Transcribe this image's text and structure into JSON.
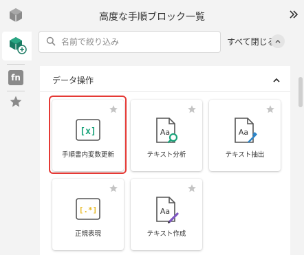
{
  "panel": {
    "title": "高度な手順ブロック一覧",
    "expand_icon": "double-chevron-right-icon"
  },
  "search": {
    "placeholder": "名前で絞り込み",
    "value": ""
  },
  "toolbar": {
    "collapse_all_label": "すべて閉じる"
  },
  "rail": {
    "items": [
      "cube-icon",
      "cube-add-icon",
      "fn-icon",
      "star-icon"
    ],
    "fn_label": "fn"
  },
  "section": {
    "title": "データ操作"
  },
  "cards": [
    {
      "label": "手順書内変数更新",
      "icon": "variable-icon",
      "icon_text": "[x]",
      "highlighted": true
    },
    {
      "label": "テキスト分析",
      "icon": "text-analyze-icon",
      "icon_text": "Aa"
    },
    {
      "label": "テキスト抽出",
      "icon": "text-extract-icon",
      "icon_text": "Aa"
    },
    {
      "label": "正規表現",
      "icon": "regex-icon",
      "icon_text": "[.*]"
    },
    {
      "label": "テキスト作成",
      "icon": "text-create-icon",
      "icon_text": "Aa"
    }
  ],
  "colors": {
    "variable_green": "#1aa37a",
    "regex_yellow": "#e8b923",
    "search_green": "#1aa37a",
    "dropper_blue": "#2e86c9",
    "pencil_purple": "#7e57c2",
    "highlight_red": "#e53935"
  }
}
